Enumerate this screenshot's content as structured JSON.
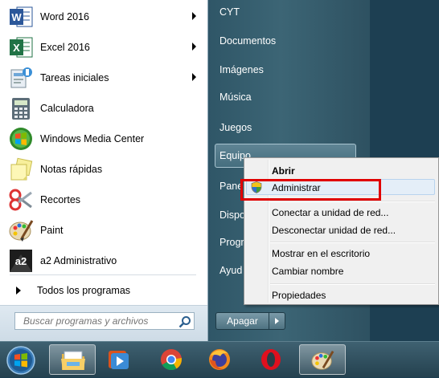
{
  "programs": [
    {
      "label": "Word 2016",
      "icon": "word-icon",
      "has_arrow": true
    },
    {
      "label": "Excel 2016",
      "icon": "excel-icon",
      "has_arrow": true
    },
    {
      "label": "Tareas iniciales",
      "icon": "getting-started-icon",
      "has_arrow": true
    },
    {
      "label": "Calculadora",
      "icon": "calculator-icon",
      "has_arrow": false
    },
    {
      "label": "Windows Media Center",
      "icon": "media-center-icon",
      "has_arrow": false
    },
    {
      "label": "Notas rápidas",
      "icon": "sticky-notes-icon",
      "has_arrow": false
    },
    {
      "label": "Recortes",
      "icon": "snipping-tool-icon",
      "has_arrow": false
    },
    {
      "label": "Paint",
      "icon": "paint-icon",
      "has_arrow": false
    },
    {
      "label": "a2 Administrativo",
      "icon": "a2-icon",
      "has_arrow": false
    }
  ],
  "all_programs_label": "Todos los programas",
  "search": {
    "placeholder": "Buscar programas y archivos"
  },
  "right_panel": {
    "items": [
      "CYT",
      "Documentos",
      "Imágenes",
      "Música",
      "Juegos",
      "Equipo",
      "Panel de control",
      "Dispositivos e impresoras",
      "Programas predeterminados",
      "Ayuda y soporte técnico"
    ],
    "visible": [
      "CYT",
      "Documentos",
      "Imágenes",
      "Música",
      "Juegos",
      "Equipo",
      "Pane",
      "Dispo",
      "Progr",
      "Ayud"
    ]
  },
  "shutdown": {
    "label": "Apagar"
  },
  "context_menu": {
    "open": "Abrir",
    "manage": "Administrar",
    "map_drive": "Conectar a unidad de red...",
    "disconnect_drive": "Desconectar unidad de red...",
    "show_desktop": "Mostrar en el escritorio",
    "rename": "Cambiar nombre",
    "properties": "Propiedades"
  },
  "taskbar": {
    "items": [
      "start-orb",
      "file-explorer-icon",
      "media-player-icon",
      "chrome-icon",
      "firefox-icon",
      "opera-icon",
      "paint-icon"
    ],
    "active": [
      "file-explorer-icon",
      "paint-icon"
    ]
  },
  "colors": {
    "highlight_frame": "#e00000",
    "menu_bg": "#f0f0f0",
    "right_panel": "#3c6575"
  }
}
